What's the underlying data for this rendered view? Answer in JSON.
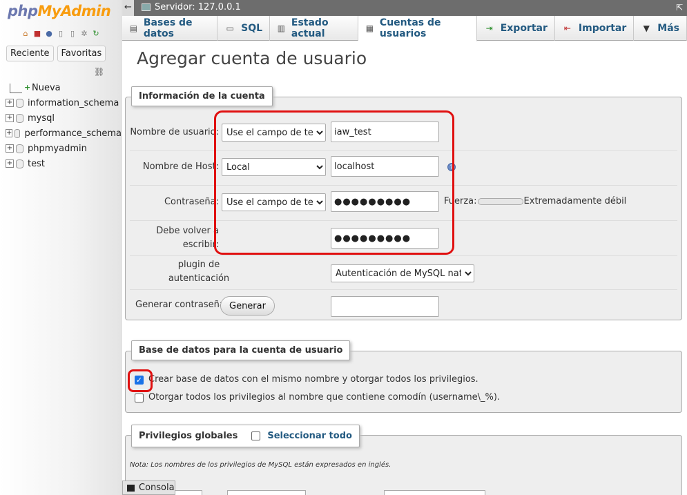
{
  "sidebar": {
    "logo_php": "php",
    "logo_rest": "MyAdmin",
    "icons": [
      "home-icon",
      "exit-icon",
      "help-icon",
      "docs-icon",
      "copy-icon",
      "settings-icon",
      "reload-icon"
    ],
    "tabs": [
      "Reciente",
      "Favoritas"
    ],
    "tree": [
      {
        "label": "Nueva",
        "type": "new"
      },
      {
        "label": "information_schema",
        "type": "db"
      },
      {
        "label": "mysql",
        "type": "db"
      },
      {
        "label": "performance_schema",
        "type": "db"
      },
      {
        "label": "phpmyadmin",
        "type": "db"
      },
      {
        "label": "test",
        "type": "db"
      }
    ]
  },
  "topbar": {
    "collapse": "←",
    "server": "Servidor: 127.0.0.1",
    "maximize": "⇱"
  },
  "tabs": [
    {
      "label": "Bases de datos",
      "icon": "databases-icon"
    },
    {
      "label": "SQL",
      "icon": "sql-icon"
    },
    {
      "label": "Estado actual",
      "icon": "status-icon"
    },
    {
      "label": "Cuentas de usuarios",
      "icon": "users-icon",
      "active": true
    },
    {
      "label": "Exportar",
      "icon": "export-icon"
    },
    {
      "label": "Importar",
      "icon": "import-icon"
    },
    {
      "label": "Más",
      "icon": "chevron-down-icon"
    }
  ],
  "main": {
    "title": "Agregar cuenta de usuario",
    "account": {
      "legend": "Información de la cuenta",
      "username_label": "Nombre de usuario:",
      "username_mode": "Use el campo de texto",
      "username_value": "iaw_test",
      "host_label": "Nombre de Host:",
      "host_mode": "Local",
      "host_value": "localhost",
      "password_label": "Contraseña:",
      "password_mode": "Use el campo de texto",
      "password_value": "●●●●●●●●●",
      "strength_label": "Fuerza:",
      "strength_text": "Extremadamente débil",
      "strength_level": 0,
      "retype_label_1": "Debe volver a",
      "retype_label_2": "escribir:",
      "retype_value": "●●●●●●●●●",
      "plugin_label_1": "plugin de",
      "plugin_label_2": "autenticación",
      "plugin_value": "Autenticación de MySQL nativo",
      "generate_label": "Generar contraseña:",
      "generate_button": "Generar",
      "generated_value": ""
    },
    "database": {
      "legend": "Base de datos para la cuenta de usuario",
      "option1": "Crear base de datos con el mismo nombre y otorgar todos los privilegios.",
      "option1_checked": true,
      "option2": "Otorgar todos los privilegios al nombre que contiene comodín (username\\_%).",
      "option2_checked": false
    },
    "privileges": {
      "legend": "Privilegios globales",
      "select_all": "Seleccionar todo",
      "note": "Nota: Los nombres de los privilegios de MySQL están expresados en inglés."
    }
  },
  "console": {
    "label": "Consola"
  },
  "colors": {
    "accent": "#235a81",
    "highlight": "#e01010",
    "logo_php": "#6c78af",
    "logo_rest": "#f89c0e"
  }
}
